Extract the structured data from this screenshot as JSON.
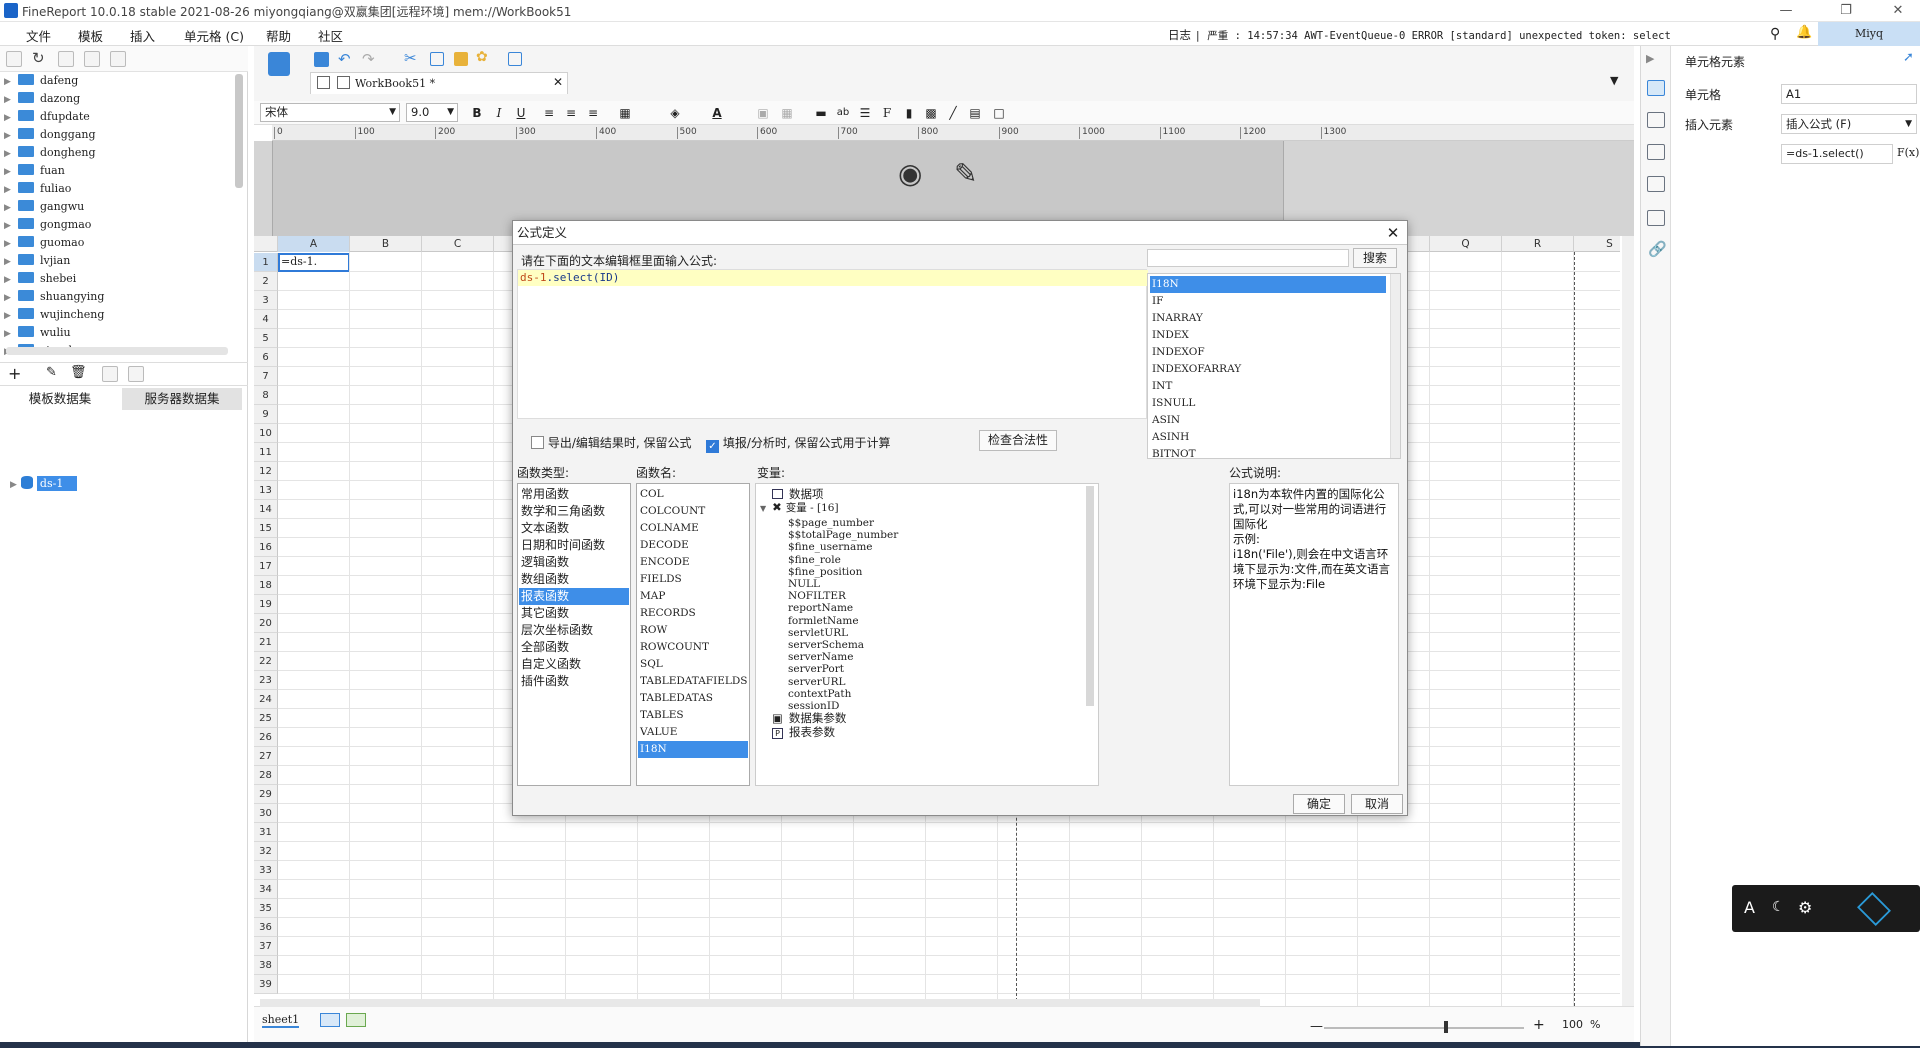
{
  "window": {
    "title": "FineReport 10.0.18 stable 2021-08-26 miyongqiang@双嬴集团[远程环境]    mem://WorkBook51",
    "minimize": "—",
    "restore": "❐",
    "close": "✕"
  },
  "menubar": {
    "items": [
      "文件",
      "模板",
      "插入",
      "单元格 (C)",
      "帮助",
      "社区"
    ],
    "log_label": "日志",
    "log_text": "| 严重 : 14:57:34 AWT-EventQueue-0 ERROR [standard] unexpected token: select",
    "user": "Miyq"
  },
  "left_panel": {
    "tree": [
      "dafeng",
      "dazong",
      "dfupdate",
      "donggang",
      "dongheng",
      "fuan",
      "fuliao",
      "gangwu",
      "gongmao",
      "guomao",
      "lvjian",
      "shebei",
      "shuangying",
      "wujincheng",
      "wuliu",
      "xiaoshou"
    ],
    "tab_template": "模板数据集",
    "tab_server": "服务器数据集",
    "dataset": "ds-1"
  },
  "editor": {
    "doc_tab": "WorkBook51 *",
    "font": "宋体",
    "font_size": "9.0",
    "ruler": [
      "0",
      "100",
      "200",
      "300",
      "400",
      "500",
      "600",
      "700",
      "800",
      "900",
      "1000",
      "1100",
      "1200",
      "1300"
    ],
    "columns": [
      "A",
      "B",
      "C",
      "D",
      "E",
      "F",
      "G",
      "H",
      "I",
      "J",
      "K",
      "L",
      "M",
      "N",
      "O",
      "P",
      "Q",
      "R",
      "S"
    ],
    "rows": [
      "1",
      "2",
      "3",
      "4",
      "5",
      "6",
      "7",
      "8",
      "9",
      "10",
      "11",
      "12",
      "13",
      "14",
      "15",
      "16",
      "17",
      "18",
      "19",
      "20",
      "21",
      "22",
      "23",
      "24",
      "25",
      "26",
      "27",
      "28",
      "29",
      "30",
      "31",
      "32",
      "33",
      "34",
      "35",
      "36",
      "37",
      "38",
      "39"
    ],
    "cell_a1": "=ds-1.",
    "sheet_tab": "sheet1",
    "zoom": "100",
    "zoom_unit": "%"
  },
  "right_panel": {
    "title": "单元格元素",
    "cell_label": "单元格",
    "cell_value": "A1",
    "insert_label": "插入元素",
    "insert_value": "插入公式 (F)",
    "formula_value": "=ds-1.select()",
    "fx": "F(x)"
  },
  "dialog": {
    "title": "公式定义",
    "prompt": "请在下面的文本编辑框里面输入公式:",
    "formula_prefix": "ds-1",
    "formula_rest": ".select(ID)",
    "search_button": "搜索",
    "search_results": [
      "I18N",
      "IF",
      "INARRAY",
      "INDEX",
      "INDEXOF",
      "INDEXOFARRAY",
      "INT",
      "ISNULL",
      "ASIN",
      "ASINH",
      "BITNOT"
    ],
    "option_export": "导出/编辑结果时, 保留公式",
    "option_fill": "填报/分析时, 保留公式用于计算",
    "check_button": "检查合法性",
    "fn_type_label": "函数类型:",
    "fn_types": [
      "常用函数",
      "数学和三角函数",
      "文本函数",
      "日期和时间函数",
      "逻辑函数",
      "数组函数",
      "报表函数",
      "其它函数",
      "层次坐标函数",
      "全部函数",
      "自定义函数",
      "插件函数"
    ],
    "fn_name_label": "函数名:",
    "fn_names": [
      "COL",
      "COLCOUNT",
      "COLNAME",
      "DECODE",
      "ENCODE",
      "FIELDS",
      "MAP",
      "RECORDS",
      "ROW",
      "ROWCOUNT",
      "SQL",
      "TABLEDATAFIELDS",
      "TABLEDATAS",
      "TABLES",
      "VALUE",
      "I18N"
    ],
    "var_label": "变量:",
    "var_root": "数据项",
    "var_group": "变量 - [16]",
    "variables": [
      "$$page_number",
      "$$totalPage_number",
      "$fine_username",
      "$fine_role",
      "$fine_position",
      "NULL",
      "NOFILTER",
      "reportName",
      "formletName",
      "servletURL",
      "serverSchema",
      "serverName",
      "serverPort",
      "serverURL",
      "contextPath",
      "sessionID"
    ],
    "var_ds_params": "数据集参数",
    "var_report_params": "报表参数",
    "desc_label": "公式说明:",
    "desc_text": "i18n为本软件内置的国际化公式,可以对一些常用的词语进行国际化\n示例:\ni18n('File'),则会在中文语言环境下显示为:文件,而在英文语言环境下显示为:File",
    "ok": "确定",
    "cancel": "取消"
  },
  "floatbar": {
    "text": "A"
  }
}
